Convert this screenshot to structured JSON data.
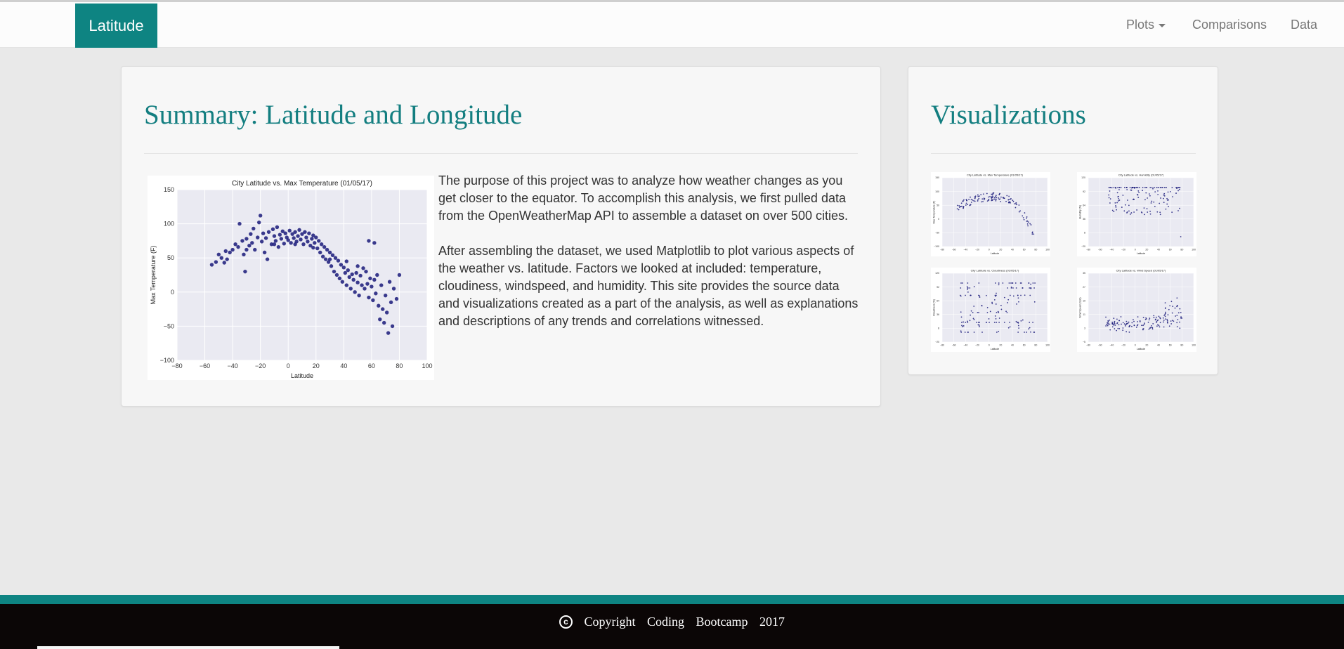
{
  "navbar": {
    "brand": "Latitude",
    "items": [
      {
        "label": "Plots",
        "dropdown": true
      },
      {
        "label": "Comparisons",
        "dropdown": false
      },
      {
        "label": "Data",
        "dropdown": false
      }
    ]
  },
  "summary": {
    "heading": "Summary: Latitude and Longitude",
    "paragraphs": [
      "The purpose of this project was to analyze how weather changes as you get closer to the equator. To accomplish this analysis, we first pulled data from the OpenWeatherMap API to assemble a dataset on over 500 cities.",
      "After assembling the dataset, we used Matplotlib to plot various aspects of the weather vs. latitude. Factors we looked at included: temperature, cloudiness, windspeed, and humidity. This site provides the source data and visualizations created as a part of the analysis, as well as explanations and descriptions of any trends and correlations witnessed."
    ]
  },
  "visualizations": {
    "heading": "Visualizations"
  },
  "footer": {
    "words": [
      "Copyright",
      "Coding",
      "Bootcamp",
      "2017"
    ]
  },
  "colors": {
    "brand": "#0e8482",
    "heading": "#137e80",
    "marker": "#1a1a7a",
    "plot_bg": "#eaeaf2"
  },
  "chart_data": [
    {
      "type": "scatter",
      "title": "City Latitude vs. Max Temperature (01/05/17)",
      "xlabel": "Latitude",
      "ylabel": "Max Temperature (F)",
      "xlim": [
        -80,
        100
      ],
      "ylim": [
        -100,
        150
      ],
      "xticks": [
        -80,
        -60,
        -40,
        -20,
        0,
        20,
        40,
        60,
        80,
        100
      ],
      "yticks": [
        -100,
        -50,
        0,
        50,
        100,
        150
      ],
      "grid": true,
      "points": [
        [
          -55,
          40
        ],
        [
          -52,
          44
        ],
        [
          -50,
          55
        ],
        [
          -48,
          50
        ],
        [
          -46,
          43
        ],
        [
          -45,
          60
        ],
        [
          -42,
          58
        ],
        [
          -40,
          62
        ],
        [
          -38,
          70
        ],
        [
          -36,
          66
        ],
        [
          -35,
          100
        ],
        [
          -33,
          75
        ],
        [
          -32,
          55
        ],
        [
          -31,
          30
        ],
        [
          -30,
          78
        ],
        [
          -28,
          68
        ],
        [
          -27,
          85
        ],
        [
          -26,
          72
        ],
        [
          -25,
          93
        ],
        [
          -24,
          62
        ],
        [
          -22,
          80
        ],
        [
          -21,
          102
        ],
        [
          -20,
          112
        ],
        [
          -19,
          74
        ],
        [
          -18,
          86
        ],
        [
          -17,
          58
        ],
        [
          -16,
          79
        ],
        [
          -15,
          48
        ],
        [
          -14,
          88
        ],
        [
          -12,
          70
        ],
        [
          -11,
          92
        ],
        [
          -10,
          82
        ],
        [
          -9,
          75
        ],
        [
          -8,
          95
        ],
        [
          -7,
          66
        ],
        [
          -6,
          84
        ],
        [
          -5,
          78
        ],
        [
          -4,
          89
        ],
        [
          -3,
          71
        ],
        [
          -2,
          86
        ],
        [
          -1,
          80
        ],
        [
          0,
          76
        ],
        [
          1,
          90
        ],
        [
          2,
          72
        ],
        [
          3,
          85
        ],
        [
          4,
          79
        ],
        [
          5,
          88
        ],
        [
          6,
          74
        ],
        [
          7,
          82
        ],
        [
          8,
          91
        ],
        [
          9,
          77
        ],
        [
          10,
          85
        ],
        [
          11,
          70
        ],
        [
          12,
          88
        ],
        [
          13,
          80
        ],
        [
          14,
          74
        ],
        [
          15,
          86
        ],
        [
          16,
          68
        ],
        [
          17,
          78
        ],
        [
          18,
          83
        ],
        [
          19,
          72
        ],
        [
          20,
          80
        ],
        [
          21,
          64
        ],
        [
          22,
          75
        ],
        [
          23,
          58
        ],
        [
          24,
          70
        ],
        [
          25,
          52
        ],
        [
          26,
          66
        ],
        [
          27,
          48
        ],
        [
          28,
          62
        ],
        [
          29,
          44
        ],
        [
          30,
          58
        ],
        [
          31,
          38
        ],
        [
          32,
          54
        ],
        [
          33,
          30
        ],
        [
          34,
          50
        ],
        [
          35,
          25
        ],
        [
          36,
          46
        ],
        [
          37,
          20
        ],
        [
          38,
          40
        ],
        [
          39,
          15
        ],
        [
          40,
          36
        ],
        [
          41,
          28
        ],
        [
          42,
          10
        ],
        [
          43,
          32
        ],
        [
          44,
          22
        ],
        [
          45,
          5
        ],
        [
          46,
          26
        ],
        [
          47,
          18
        ],
        [
          48,
          0
        ],
        [
          49,
          28
        ],
        [
          50,
          14
        ],
        [
          51,
          -5
        ],
        [
          52,
          24
        ],
        [
          53,
          10
        ],
        [
          54,
          35
        ],
        [
          55,
          5
        ],
        [
          56,
          30
        ],
        [
          57,
          12
        ],
        [
          58,
          -8
        ],
        [
          59,
          20
        ],
        [
          60,
          8
        ],
        [
          61,
          -12
        ],
        [
          62,
          18
        ],
        [
          63,
          -2
        ],
        [
          64,
          25
        ],
        [
          65,
          -20
        ],
        [
          66,
          -40
        ],
        [
          67,
          10
        ],
        [
          68,
          -25
        ],
        [
          69,
          -45
        ],
        [
          70,
          -5
        ],
        [
          71,
          -30
        ],
        [
          72,
          -60
        ],
        [
          73,
          15
        ],
        [
          74,
          -15
        ],
        [
          75,
          -50
        ],
        [
          76,
          5
        ],
        [
          78,
          -10
        ],
        [
          80,
          25
        ],
        [
          -44,
          48
        ],
        [
          -30,
          62
        ],
        [
          -10,
          70
        ],
        [
          5,
          70
        ],
        [
          18,
          65
        ],
        [
          30,
          48
        ],
        [
          42,
          45
        ],
        [
          50,
          38
        ],
        [
          58,
          75
        ],
        [
          62,
          72
        ]
      ]
    },
    {
      "type": "scatter",
      "title": "City Latitude vs. Max Temperature (01/05/17)",
      "xlabel": "Latitude",
      "ylabel": "Max Temperature (F)",
      "xlim": [
        -80,
        100
      ],
      "ylim": [
        -100,
        150
      ],
      "grid": true,
      "pattern": "arch"
    },
    {
      "type": "scatter",
      "title": "City Latitude vs. Humidity (01/05/17)",
      "xlabel": "Latitude",
      "ylabel": "Humidity (%)",
      "xlim": [
        -80,
        100
      ],
      "ylim": [
        -20,
        120
      ],
      "grid": true,
      "pattern": "humidity"
    },
    {
      "type": "scatter",
      "title": "City Latitude vs. Cloudiness (01/05/17)",
      "xlabel": "Latitude",
      "ylabel": "Cloudiness (%)",
      "xlim": [
        -80,
        100
      ],
      "ylim": [
        -20,
        120
      ],
      "grid": true,
      "pattern": "cloudiness"
    },
    {
      "type": "scatter",
      "title": "City Latitude vs. Wind Speed (01/05/17)",
      "xlabel": "Latitude",
      "ylabel": "Wind Speed (mph)",
      "xlim": [
        -80,
        100
      ],
      "ylim": [
        -5,
        35
      ],
      "grid": true,
      "pattern": "wind"
    }
  ]
}
